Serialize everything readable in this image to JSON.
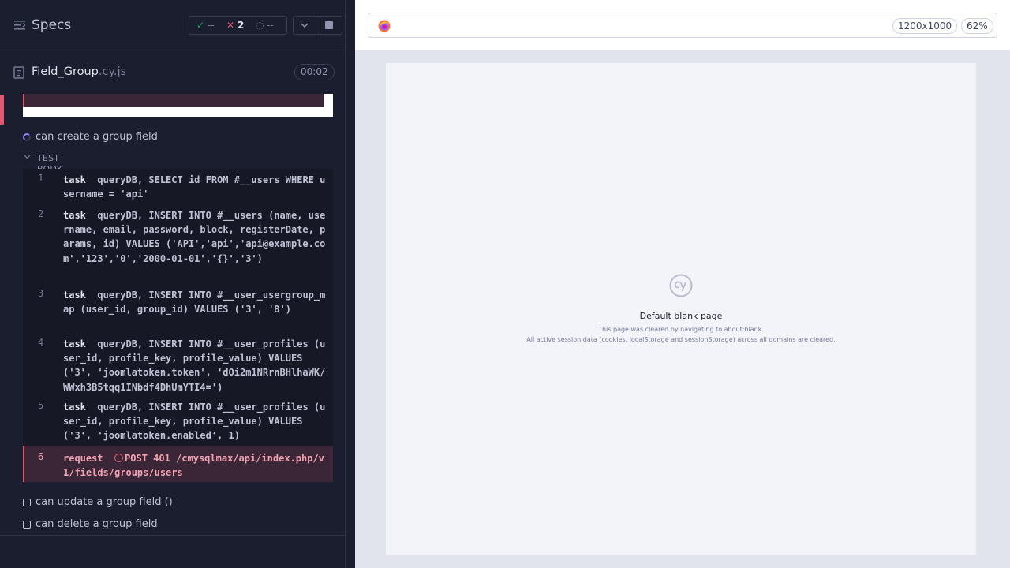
{
  "reporter": {
    "title": "Specs",
    "stats": {
      "passed": "--",
      "failed": "2",
      "pending": "--"
    },
    "file": {
      "name": "Field_Group",
      "ext": ".cy.js",
      "duration": "00:02"
    },
    "tests": [
      {
        "label": "can create a group field",
        "state": "running"
      },
      {
        "label": "can update a group field ()",
        "state": "queued"
      },
      {
        "label": "can delete a group field",
        "state": "queued"
      }
    ],
    "test_body_label": "TEST BODY",
    "commands": [
      {
        "num": "1",
        "name": "task",
        "message": "queryDB, SELECT id FROM #__users WHERE username = 'api'"
      },
      {
        "num": "2",
        "name": "task",
        "message": "queryDB, INSERT INTO #__users (name, username, email, password, block, registerDate, params, id) VALUES ('API','api','api@example.com','123','0','2000-01-01','{}','3')"
      },
      {
        "num": "3",
        "name": "task",
        "message": "queryDB, INSERT INTO #__user_usergroup_map (user_id, group_id) VALUES ('3', '8')"
      },
      {
        "num": "4",
        "name": "task",
        "message": "queryDB, INSERT INTO #__user_profiles (user_id, profile_key, profile_value) VALUES ('3', 'joomlatoken.token', 'dOi2m1NRrnBHlhaWK/WWxh3B5tqq1INbdf4DhUmYTI4=')"
      },
      {
        "num": "5",
        "name": "task",
        "message": "queryDB, INSERT INTO #__user_profiles (user_id, profile_key, profile_value) VALUES ('3', 'joomlatoken.enabled', 1)"
      },
      {
        "num": "6",
        "name": "request",
        "message": "POST 401 /cmysqlmax/api/index.php/v1/fields/groups/users"
      }
    ]
  },
  "aut": {
    "viewport": "1200x1000",
    "zoom": "62%",
    "blank_title": "Default blank page",
    "blank_line1": "This page was cleared by navigating to about:blank.",
    "blank_line2": "All active session data (cookies, localStorage and sessionStorage) across all domains are cleared."
  },
  "colors": {
    "background": "#1b1e2e",
    "pass": "#1fa971",
    "fail": "#e45770",
    "running": "#8f8af7"
  },
  "icons": [
    "menu-icon",
    "check-icon",
    "x-icon",
    "spinner-icon",
    "chevron-down-icon",
    "stop-icon",
    "document-icon",
    "firefox-icon",
    "cypress-logo"
  ]
}
